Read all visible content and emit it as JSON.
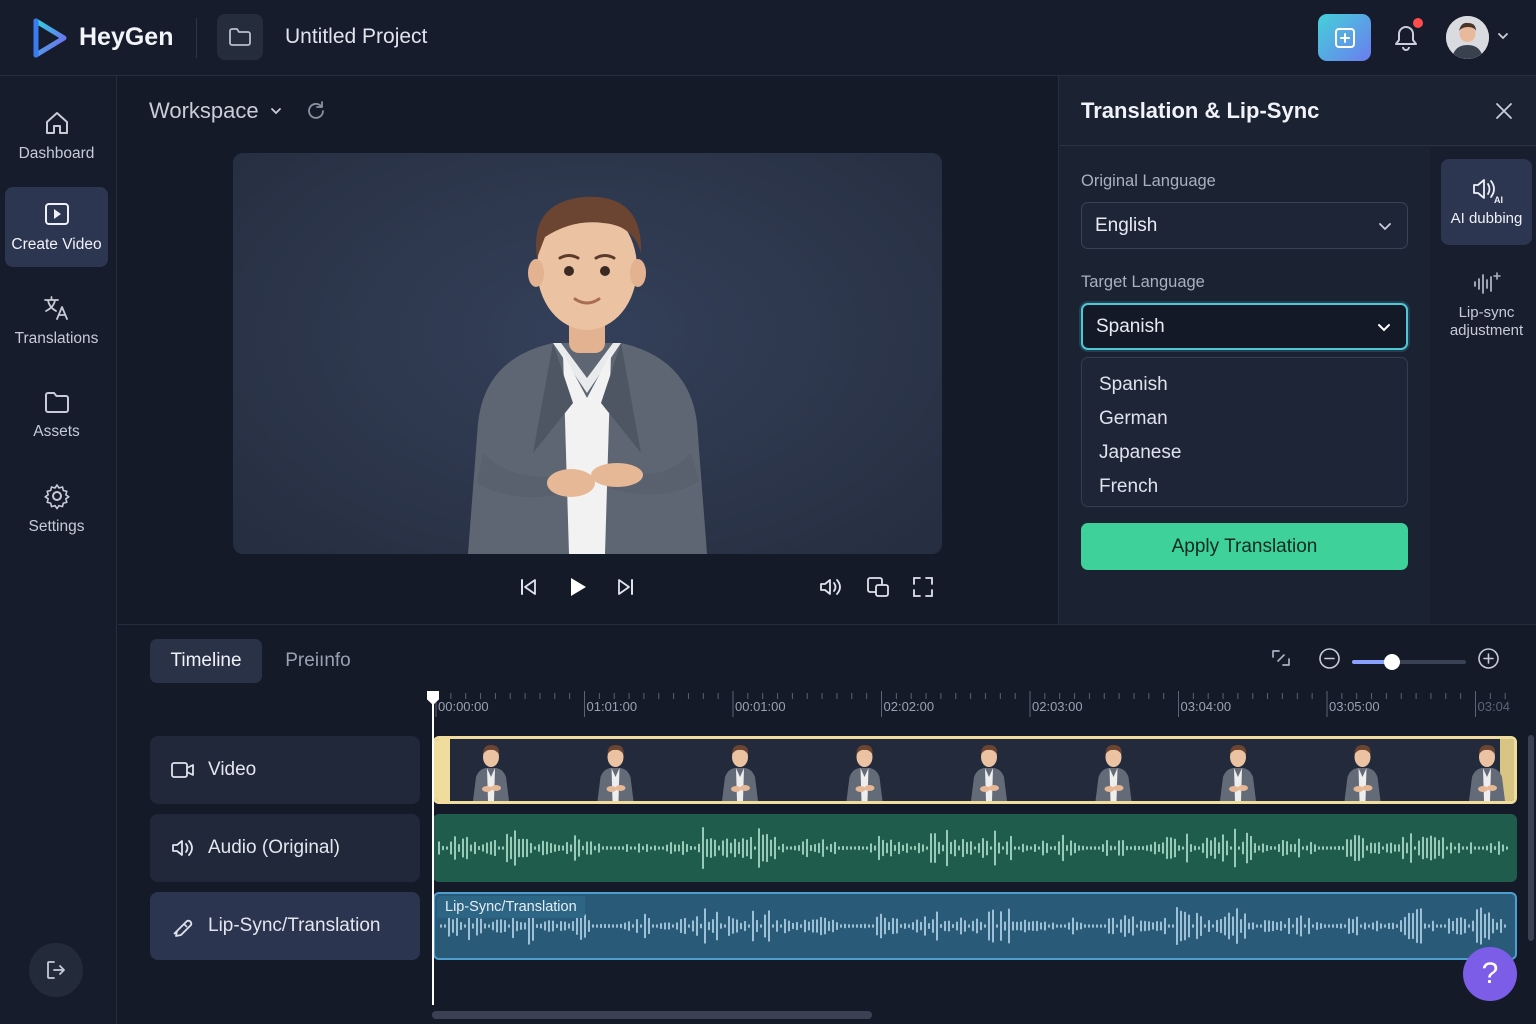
{
  "header": {
    "brand": "HeyGen",
    "project_title": "Untitled Project",
    "accent_gradient": [
      "#44d1d8",
      "#6b7cf0"
    ]
  },
  "sidebar": {
    "items": [
      {
        "label": "Dashboard",
        "icon": "home-icon"
      },
      {
        "label": "Create Video",
        "icon": "play-square-icon",
        "active": true
      },
      {
        "label": "Translations",
        "icon": "translate-icon"
      },
      {
        "label": "Assets",
        "icon": "folder-icon"
      },
      {
        "label": "Settings",
        "icon": "gear-icon"
      }
    ]
  },
  "workspace": {
    "label": "Workspace"
  },
  "panel": {
    "title": "Translation & Lip-Sync",
    "original_language_label": "Original Language",
    "original_language_value": "English",
    "target_language_label": "Target Language",
    "target_language_value": "Spanish",
    "options": [
      "Spanish",
      "German",
      "Japanese",
      "French"
    ],
    "apply_label": "Apply Translation",
    "apply_color": "#3ed29a",
    "tools": [
      {
        "label": "AI dubbing",
        "icon": "speaker-ai-icon",
        "active": true
      },
      {
        "label": "Lip-sync adjustment",
        "icon": "waveform-sparkle-icon"
      }
    ]
  },
  "timeline": {
    "tabs": [
      {
        "label": "Timeline",
        "active": true
      },
      {
        "label": "Preiınfo"
      }
    ],
    "zoom_level": 0.35,
    "ruler_labels": [
      "00:00:00",
      "01:01:00",
      "00:01:00",
      "02:02:00",
      "02:03:00",
      "03:04:00",
      "03:05:00",
      "03:04"
    ],
    "tracks": [
      {
        "label": "Video",
        "icon": "video-camera-icon"
      },
      {
        "label": "Audio (Original)",
        "icon": "speaker-icon"
      },
      {
        "label": "Lip-Sync/Translation",
        "icon": "lip-sync-icon",
        "active": true
      }
    ],
    "lip_clip_label": "Lip-Sync/Translation",
    "scroll_position": 0.0
  },
  "help": {
    "label": "?"
  }
}
